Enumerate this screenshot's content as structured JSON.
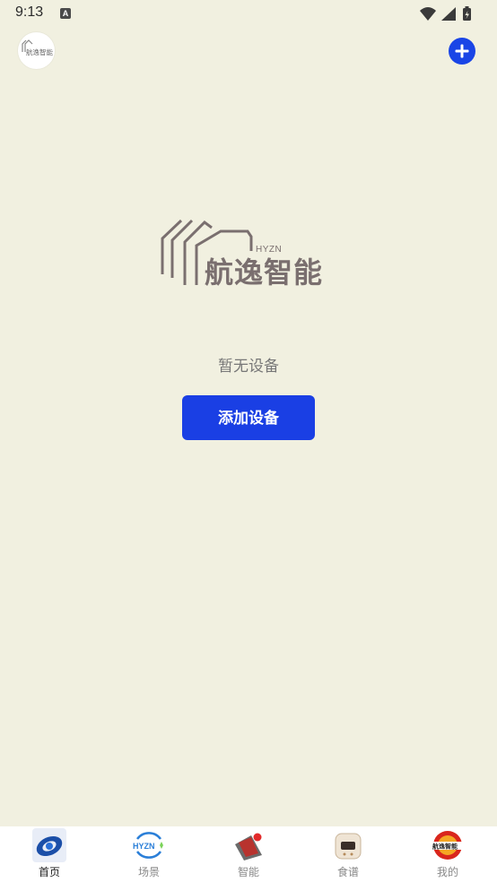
{
  "status_bar": {
    "time": "9:13",
    "notif_glyph": "A"
  },
  "header": {
    "avatar_logo_text": "航逸智能"
  },
  "brand": {
    "sub": "HYZN",
    "name": "航逸智能"
  },
  "empty_state": {
    "message": "暂无设备",
    "add_button": "添加设备"
  },
  "tabs": [
    {
      "label": "首页",
      "icon": "home-icon",
      "active": true
    },
    {
      "label": "场景",
      "icon": "scene-icon",
      "active": false,
      "icon_text": "HYZN"
    },
    {
      "label": "智能",
      "icon": "smart-icon",
      "active": false
    },
    {
      "label": "食谱",
      "icon": "recipe-icon",
      "active": false
    },
    {
      "label": "我的",
      "icon": "profile-icon",
      "active": false,
      "icon_text": "航逸智能"
    }
  ],
  "colors": {
    "background": "#f1f0e0",
    "accent": "#1a3fe4",
    "brand_gray": "#7a6f6f"
  }
}
